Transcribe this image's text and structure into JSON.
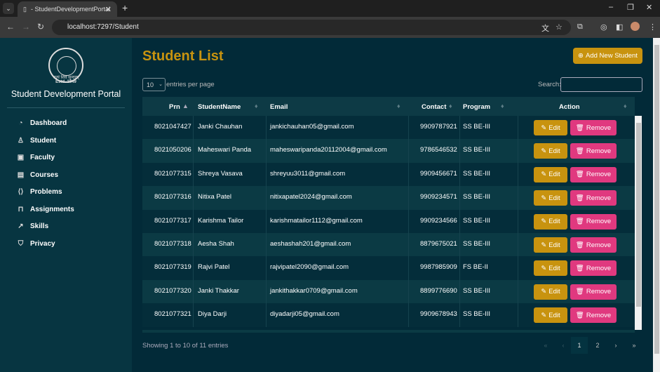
{
  "browser": {
    "tab_title": "- StudentDevelopmentPortal",
    "url": "localhost:7297/Student"
  },
  "sidebar": {
    "motto": "सत्यं शिवं सुन्दरम्",
    "estd": "Estd. 1949",
    "portal_title": "Student Development Portal",
    "items": [
      {
        "label": "Dashboard",
        "icon": "dashboard-icon"
      },
      {
        "label": "Student",
        "icon": "person-icon"
      },
      {
        "label": "Faculty",
        "icon": "faculty-icon"
      },
      {
        "label": "Courses",
        "icon": "code-file-icon"
      },
      {
        "label": "Problems",
        "icon": "code-icon"
      },
      {
        "label": "Assignments",
        "icon": "bookmark-icon"
      },
      {
        "label": "Skills",
        "icon": "chart-line-icon"
      },
      {
        "label": "Privacy",
        "icon": "shield-icon"
      }
    ]
  },
  "main": {
    "title": "Student List",
    "add_label": "Add New Student",
    "page_size": "10",
    "entries_label": "entries per page",
    "search_label": "Search:",
    "search_value": "",
    "columns": [
      "Prn",
      "StudentName",
      "Email",
      "Contact",
      "Program",
      "Action"
    ],
    "rows": [
      [
        "8021047427",
        "Janki Chauhan",
        "jankichauhan05@gmail.com",
        "9909787921",
        "SS BE-III"
      ],
      [
        "8021050206",
        "Maheswari Panda",
        "maheswaripanda20112004@gmail.com",
        "9786546532",
        "SS BE-III"
      ],
      [
        "8021077315",
        "Shreya Vasava",
        "shreyuu3011@gmail.com",
        "9909456671",
        "SS BE-III"
      ],
      [
        "8021077316",
        "Nitixa Patel",
        "nitixapatel2024@gmail.com",
        "9909234571",
        "SS BE-III"
      ],
      [
        "8021077317",
        "Karishma Tailor",
        "karishmatailor1112@gmail.com",
        "9909234566",
        "SS BE-III"
      ],
      [
        "8021077318",
        "Aesha Shah",
        "aeshashah201@gmail.com",
        "8879675021",
        "SS BE-III"
      ],
      [
        "8021077319",
        "Rajvi Patel",
        "rajvipatel2090@gmail.com",
        "9987985909",
        "FS BE-II"
      ],
      [
        "8021077320",
        "Janki Thakkar",
        "jankithakkar0709@gmail.com",
        "8899776690",
        "SS BE-III"
      ],
      [
        "8021077321",
        "Diya Darji",
        "diyadarji05@gmail.com",
        "9909678943",
        "SS BE-III"
      ]
    ],
    "edit_label": "Edit",
    "remove_label": "Remove",
    "info": "Showing 1 to 10 of 11 entries",
    "pagination": [
      "«",
      "‹",
      "1",
      "2",
      "›",
      "»"
    ],
    "current_page": "1"
  },
  "colors": {
    "accent": "#c8930f",
    "remove": "#e0397f",
    "sidebar": "#073541",
    "background": "#022a38"
  }
}
